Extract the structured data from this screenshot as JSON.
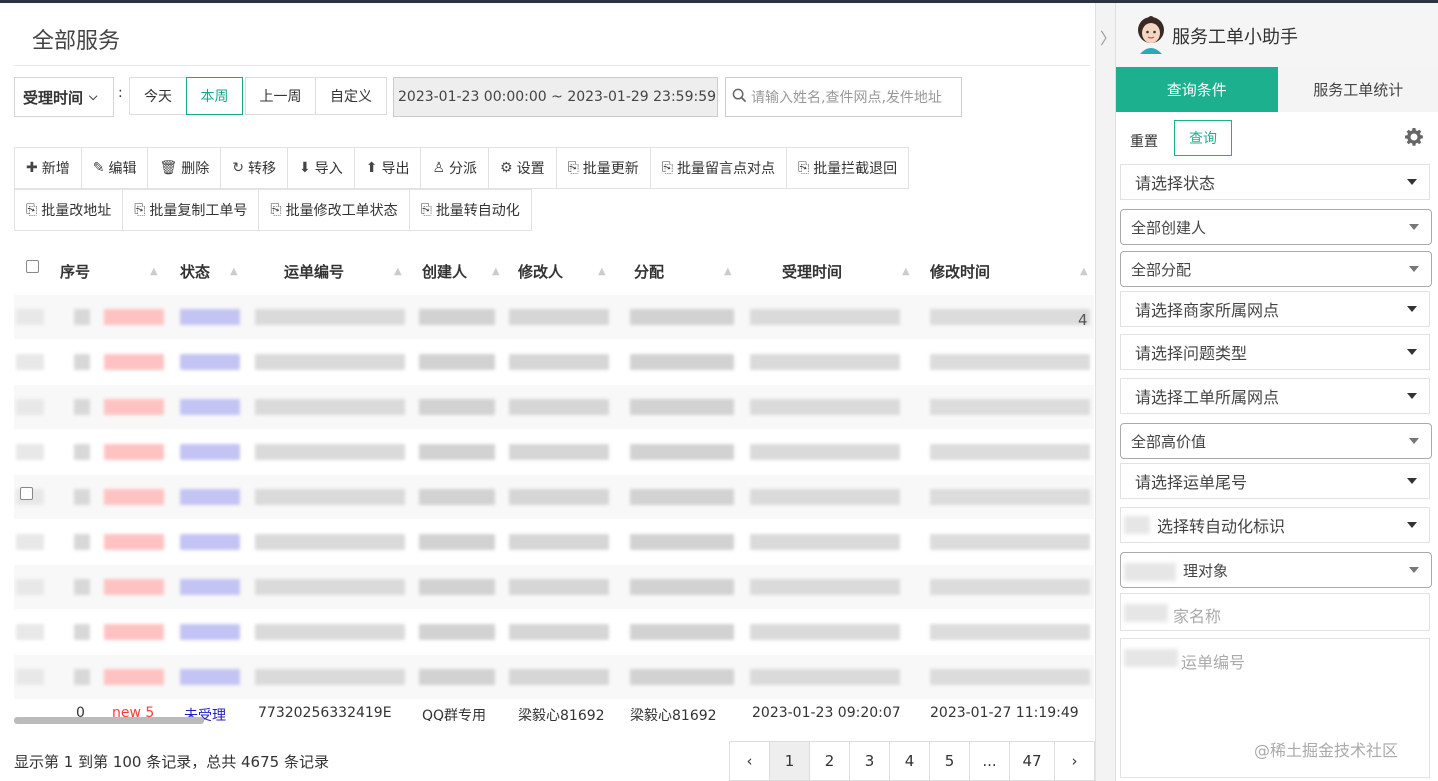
{
  "page": {
    "title": "全部服务"
  },
  "filter": {
    "time_field": "受理时间",
    "colon": ":",
    "segments": [
      "今天",
      "本周",
      "上一周",
      "自定义"
    ],
    "active_segment": "本周",
    "date_range": "2023-01-23 00:00:00 ~ 2023-01-29 23:59:59",
    "search_placeholder": "请输入姓名,查件网点,发件地址"
  },
  "toolbar": {
    "row1": [
      {
        "label": "新增",
        "icon": "plus-icon"
      },
      {
        "label": "编辑",
        "icon": "edit-icon"
      },
      {
        "label": "删除",
        "icon": "trash-icon"
      },
      {
        "label": "转移",
        "icon": "transfer-icon"
      },
      {
        "label": "导入",
        "icon": "import-icon"
      },
      {
        "label": "导出",
        "icon": "export-icon"
      },
      {
        "label": "分派",
        "icon": "user-icon"
      },
      {
        "label": "设置",
        "icon": "gear-icon"
      },
      {
        "label": "批量更新",
        "icon": "batch-edit-icon"
      },
      {
        "label": "批量留言点对点",
        "icon": "batch-edit-icon"
      },
      {
        "label": "批量拦截退回",
        "icon": "batch-edit-icon"
      }
    ],
    "row2": [
      {
        "label": "批量改地址",
        "icon": "batch-edit-icon"
      },
      {
        "label": "批量复制工单号",
        "icon": "batch-edit-icon"
      },
      {
        "label": "批量修改工单状态",
        "icon": "batch-edit-icon"
      },
      {
        "label": "批量转自动化",
        "icon": "batch-edit-icon"
      }
    ]
  },
  "table": {
    "columns": [
      "序号",
      "状态",
      "运单编号",
      "创建人",
      "修改人",
      "分配",
      "受理时间",
      "修改时间"
    ],
    "last_row": {
      "index": "0",
      "tag": "new 5",
      "status": "未受理",
      "waybill": "77320256332419E",
      "creator": "QQ群专用",
      "modifier": "梁毅心81692",
      "assign": "梁毅心81692",
      "accept_time": "2023-01-23 09:20:07",
      "modify_time": "2023-01-27 11:19:49"
    },
    "edge_char": "4"
  },
  "footer": {
    "info": "显示第 1 到第 100 条记录，总共 4675 条记录",
    "pages": [
      "‹",
      "1",
      "2",
      "3",
      "4",
      "5",
      "...",
      "47",
      "›"
    ],
    "current_page": "1"
  },
  "side": {
    "title": "服务工单小助手",
    "tabs": [
      "查询条件",
      "服务工单统计"
    ],
    "active_tab": "查询条件",
    "reset_label": "重置",
    "query_label": "查询",
    "selects": [
      {
        "label": "请选择状态",
        "style": "flat"
      },
      {
        "label": "全部创建人",
        "style": "box"
      },
      {
        "label": "全部分配",
        "style": "box"
      },
      {
        "label": "请选择商家所属网点",
        "style": "flat"
      },
      {
        "label": "请选择问题类型",
        "style": "flat"
      },
      {
        "label": "请选择工单所属网点",
        "style": "flat"
      },
      {
        "label": "全部高价值",
        "style": "box"
      },
      {
        "label": "请选择运单尾号",
        "style": "flat"
      },
      {
        "label": "选择转自动化标识",
        "style": "flat"
      },
      {
        "label": "理对象",
        "style": "box"
      }
    ],
    "inputs": [
      {
        "placeholder": "家名称"
      },
      {
        "placeholder": "运单编号"
      }
    ]
  },
  "watermark": "@稀土掘金技术社区",
  "colors": {
    "accent": "#1db08f",
    "tag_red": "#ff3b3b",
    "status_blue": "#2020c0"
  }
}
